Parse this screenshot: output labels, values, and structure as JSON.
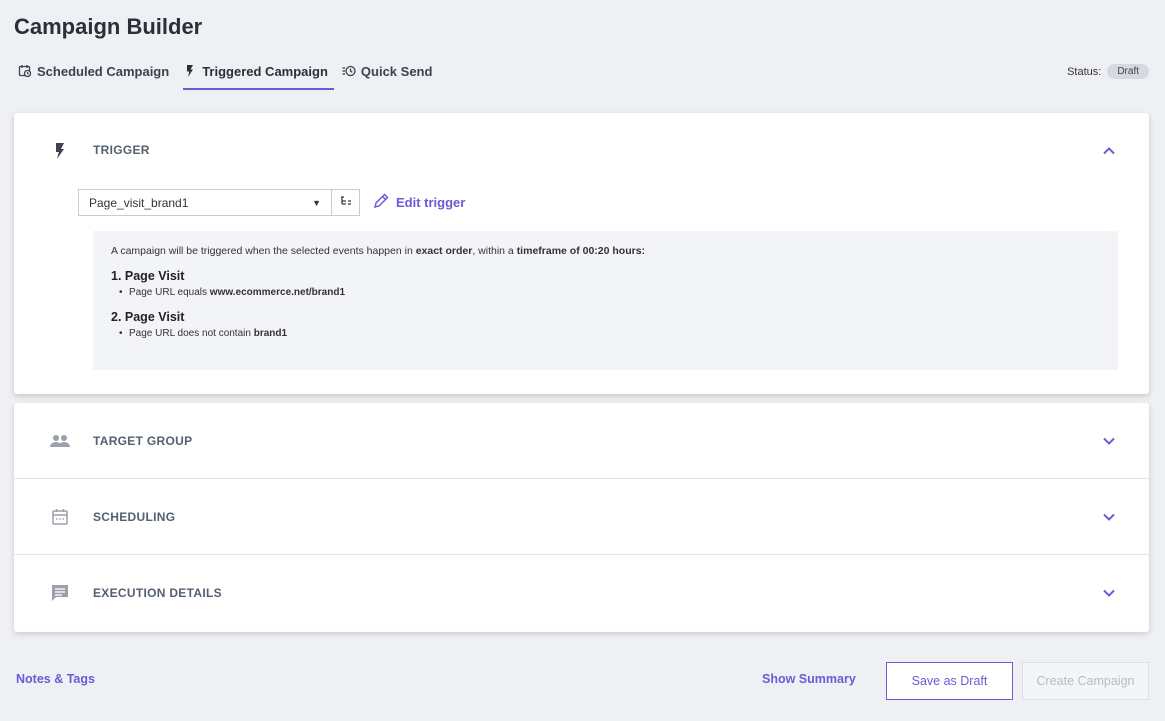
{
  "page": {
    "title": "Campaign Builder"
  },
  "tabs": [
    {
      "label": "Scheduled Campaign",
      "icon": "calendar-clock-icon"
    },
    {
      "label": "Triggered Campaign",
      "icon": "lightning-icon"
    },
    {
      "label": "Quick Send",
      "icon": "clock-list-icon"
    }
  ],
  "status": {
    "label": "Status:",
    "value": "Draft"
  },
  "trigger": {
    "title": "TRIGGER",
    "selected": "Page_visit_brand1",
    "edit_label": "Edit trigger",
    "desc_pre": "A campaign will be triggered when the selected events happen in ",
    "desc_order": "exact order",
    "desc_mid": ", within a ",
    "desc_timeframe": "timeframe of 00:20 hours:",
    "steps": [
      {
        "title": "1. Page Visit",
        "cond_pre": "Page URL equals ",
        "cond_val": "www.ecommerce.net/brand1"
      },
      {
        "title": "2. Page Visit",
        "cond_pre": "Page URL does not contain ",
        "cond_val": "brand1"
      }
    ]
  },
  "sections": [
    {
      "title": "TARGET GROUP",
      "icon": "people-icon"
    },
    {
      "title": "SCHEDULING",
      "icon": "calendar-icon"
    },
    {
      "title": "EXECUTION DETAILS",
      "icon": "message-icon"
    }
  ],
  "footer": {
    "notes_label": "Notes & Tags",
    "summary_label": "Show Summary",
    "draft_label": "Save as Draft",
    "create_label": "Create Campaign"
  },
  "colors": {
    "accent": "#6a5bd6",
    "background": "#eef0f4"
  }
}
